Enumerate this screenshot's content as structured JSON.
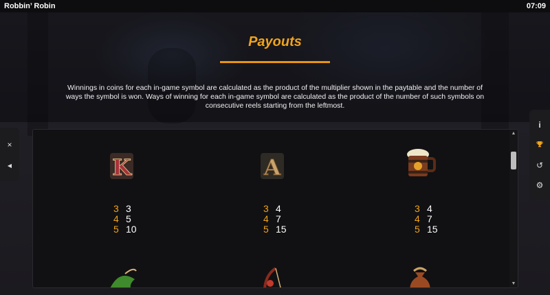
{
  "app": {
    "title": "Robbin’ Robin",
    "clock": "07:09"
  },
  "page": {
    "heading": "Payouts",
    "description": "Winnings in coins for each in-game symbol are calculated as the product of the multiplier shown in the paytable and the number of ways the symbol is won. Ways of winning for each in-game symbol are calculated as the product of the number of such symbols on consecutive reels starting from the leftmost."
  },
  "left_panel": {
    "close_icon": "×",
    "back_icon": "◀"
  },
  "right_panel": {
    "info_icon": "i",
    "trophy_icon": "🏆",
    "history_icon": "↺",
    "settings_icon": "⚙"
  },
  "scrollbar": {
    "up": "▲",
    "down": "▼"
  },
  "symbols": [
    {
      "name": "K",
      "pays": [
        {
          "count": "3",
          "value": "3"
        },
        {
          "count": "4",
          "value": "5"
        },
        {
          "count": "5",
          "value": "10"
        }
      ]
    },
    {
      "name": "A",
      "pays": [
        {
          "count": "3",
          "value": "4"
        },
        {
          "count": "4",
          "value": "7"
        },
        {
          "count": "5",
          "value": "15"
        }
      ]
    },
    {
      "name": "beer-mug",
      "pays": [
        {
          "count": "3",
          "value": "4"
        },
        {
          "count": "4",
          "value": "7"
        },
        {
          "count": "5",
          "value": "15"
        }
      ]
    }
  ],
  "colors": {
    "accent": "#f0a31c",
    "panel": "#111113"
  }
}
